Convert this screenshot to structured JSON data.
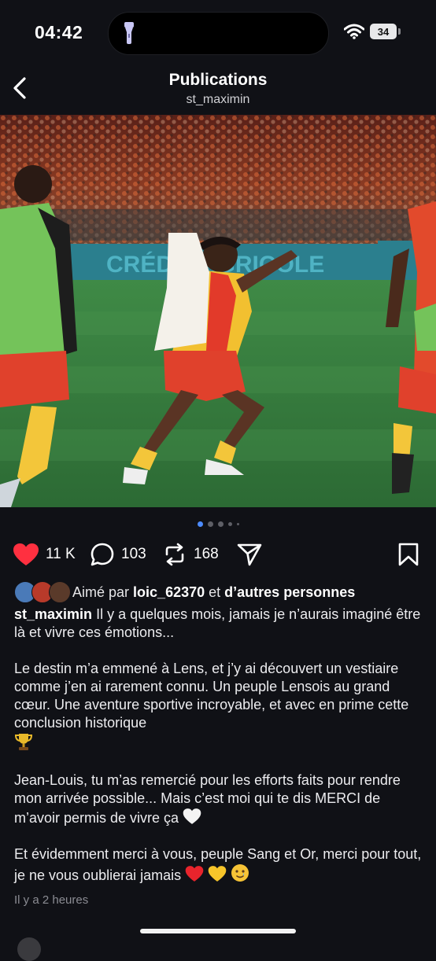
{
  "status_bar": {
    "time": "04:42",
    "battery": "34",
    "icons": [
      "flashlight-icon",
      "wifi-icon",
      "battery-icon"
    ]
  },
  "header": {
    "title": "Publications",
    "subtitle": "st_maximin",
    "back_icon": "chevron-left-icon"
  },
  "carousel": {
    "page_count": 5,
    "active_index": 0
  },
  "actions": {
    "likes": "11 K",
    "comments": "103",
    "reposts": "168",
    "icons": [
      "heart-icon",
      "comment-icon",
      "repost-icon",
      "share-icon",
      "bookmark-icon"
    ],
    "heart_color": "#ff3040"
  },
  "liked_by": {
    "prefix": "Aimé par",
    "user": "loic_62370",
    "connector": "et",
    "others": "d’autres personnes"
  },
  "caption": {
    "user": "st_maximin",
    "p1": "Il y a quelques mois, jamais je n’aurais imaginé être là et vivre ces émotions...",
    "p2": "Le destin m’a emmené à Lens, et j’y ai découvert un vestiaire comme j’en ai rarement connu. Un peuple Lensois au grand cœur. Une aventure sportive incroyable, et avec en prime cette conclusion historique",
    "p3": "Jean-Louis, tu m’as remercié pour les efforts faits pour rendre mon arrivée possible... Mais c’est moi qui te dis MERCI de m’avoir permis de vivre ça",
    "p4": "Et évidemment merci à vous, peuple Sang et Or, merci pour tout, je ne vous oublierai jamais",
    "emoji": [
      "trophy-icon",
      "white-heart-icon",
      "red-heart-icon",
      "yellow-heart-icon",
      "teary-smile-icon"
    ]
  },
  "timestamp": "Il y a 2 heures",
  "photo": {
    "banner_text": "CRÉDIT AGRICOLE"
  }
}
